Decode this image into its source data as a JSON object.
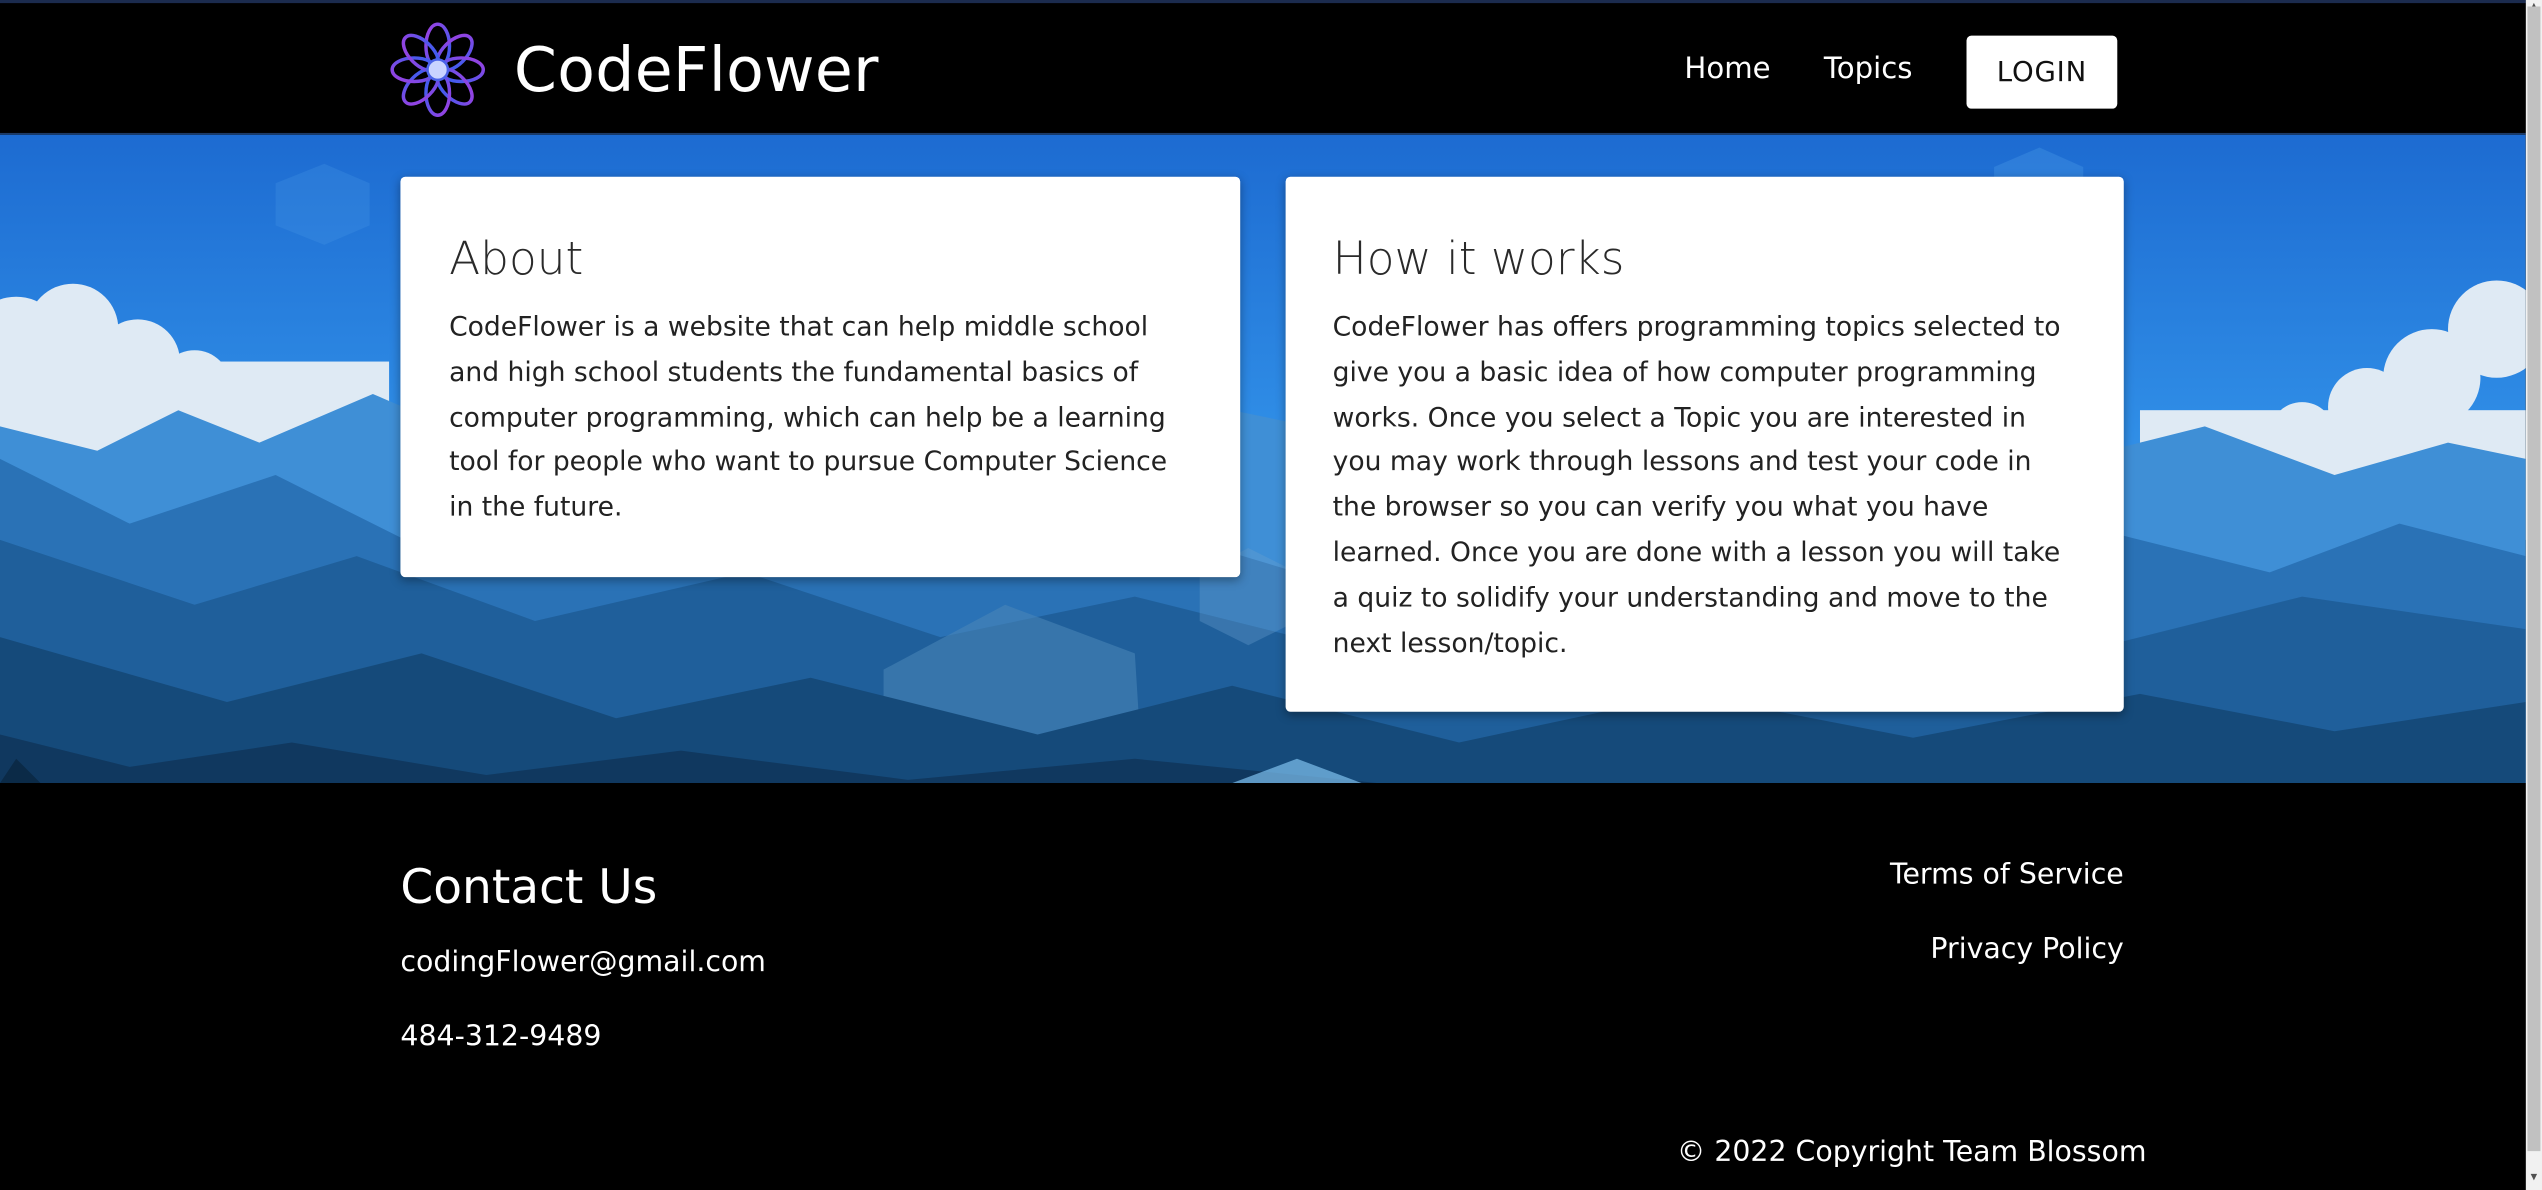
{
  "header": {
    "brand_name": "CodeFlower",
    "nav": {
      "home": "Home",
      "topics": "Topics",
      "login": "LOGIN"
    }
  },
  "about": {
    "title": "About",
    "body": "CodeFlower is a website that can help middle school and high school students the fundamental basics of computer programming, which can help be a learning tool for people who want to pursue Computer Science in the future."
  },
  "how_it_works": {
    "title": "How it works",
    "body": "CodeFlower has offers programming topics selected to give you a basic idea of how computer programming works. Once you select a Topic you are interested in you may work through lessons and test your code in the browser so you can verify you what you have learned. Once you are done with a lesson you will take a quiz to solidify your understanding and move to the next lesson/topic."
  },
  "footer": {
    "contact_title": "Contact Us",
    "email": "codingFlower@gmail.com",
    "phone": "484-312-9489",
    "terms": "Terms of Service",
    "privacy": "Privacy Policy",
    "copyright": "© 2022 Copyright Team Blossom"
  },
  "icons": {
    "logo": "flower-logo-icon",
    "scroll_up": "arrow-up-icon",
    "scroll_down": "arrow-down-icon"
  },
  "colors": {
    "navbar_bg": "#000000",
    "footer_bg": "#000000",
    "card_bg": "#ffffff",
    "sky_top": "#1e6fd0",
    "logo_purple": "#7b3fe4",
    "logo_blue": "#3b5ff0"
  }
}
